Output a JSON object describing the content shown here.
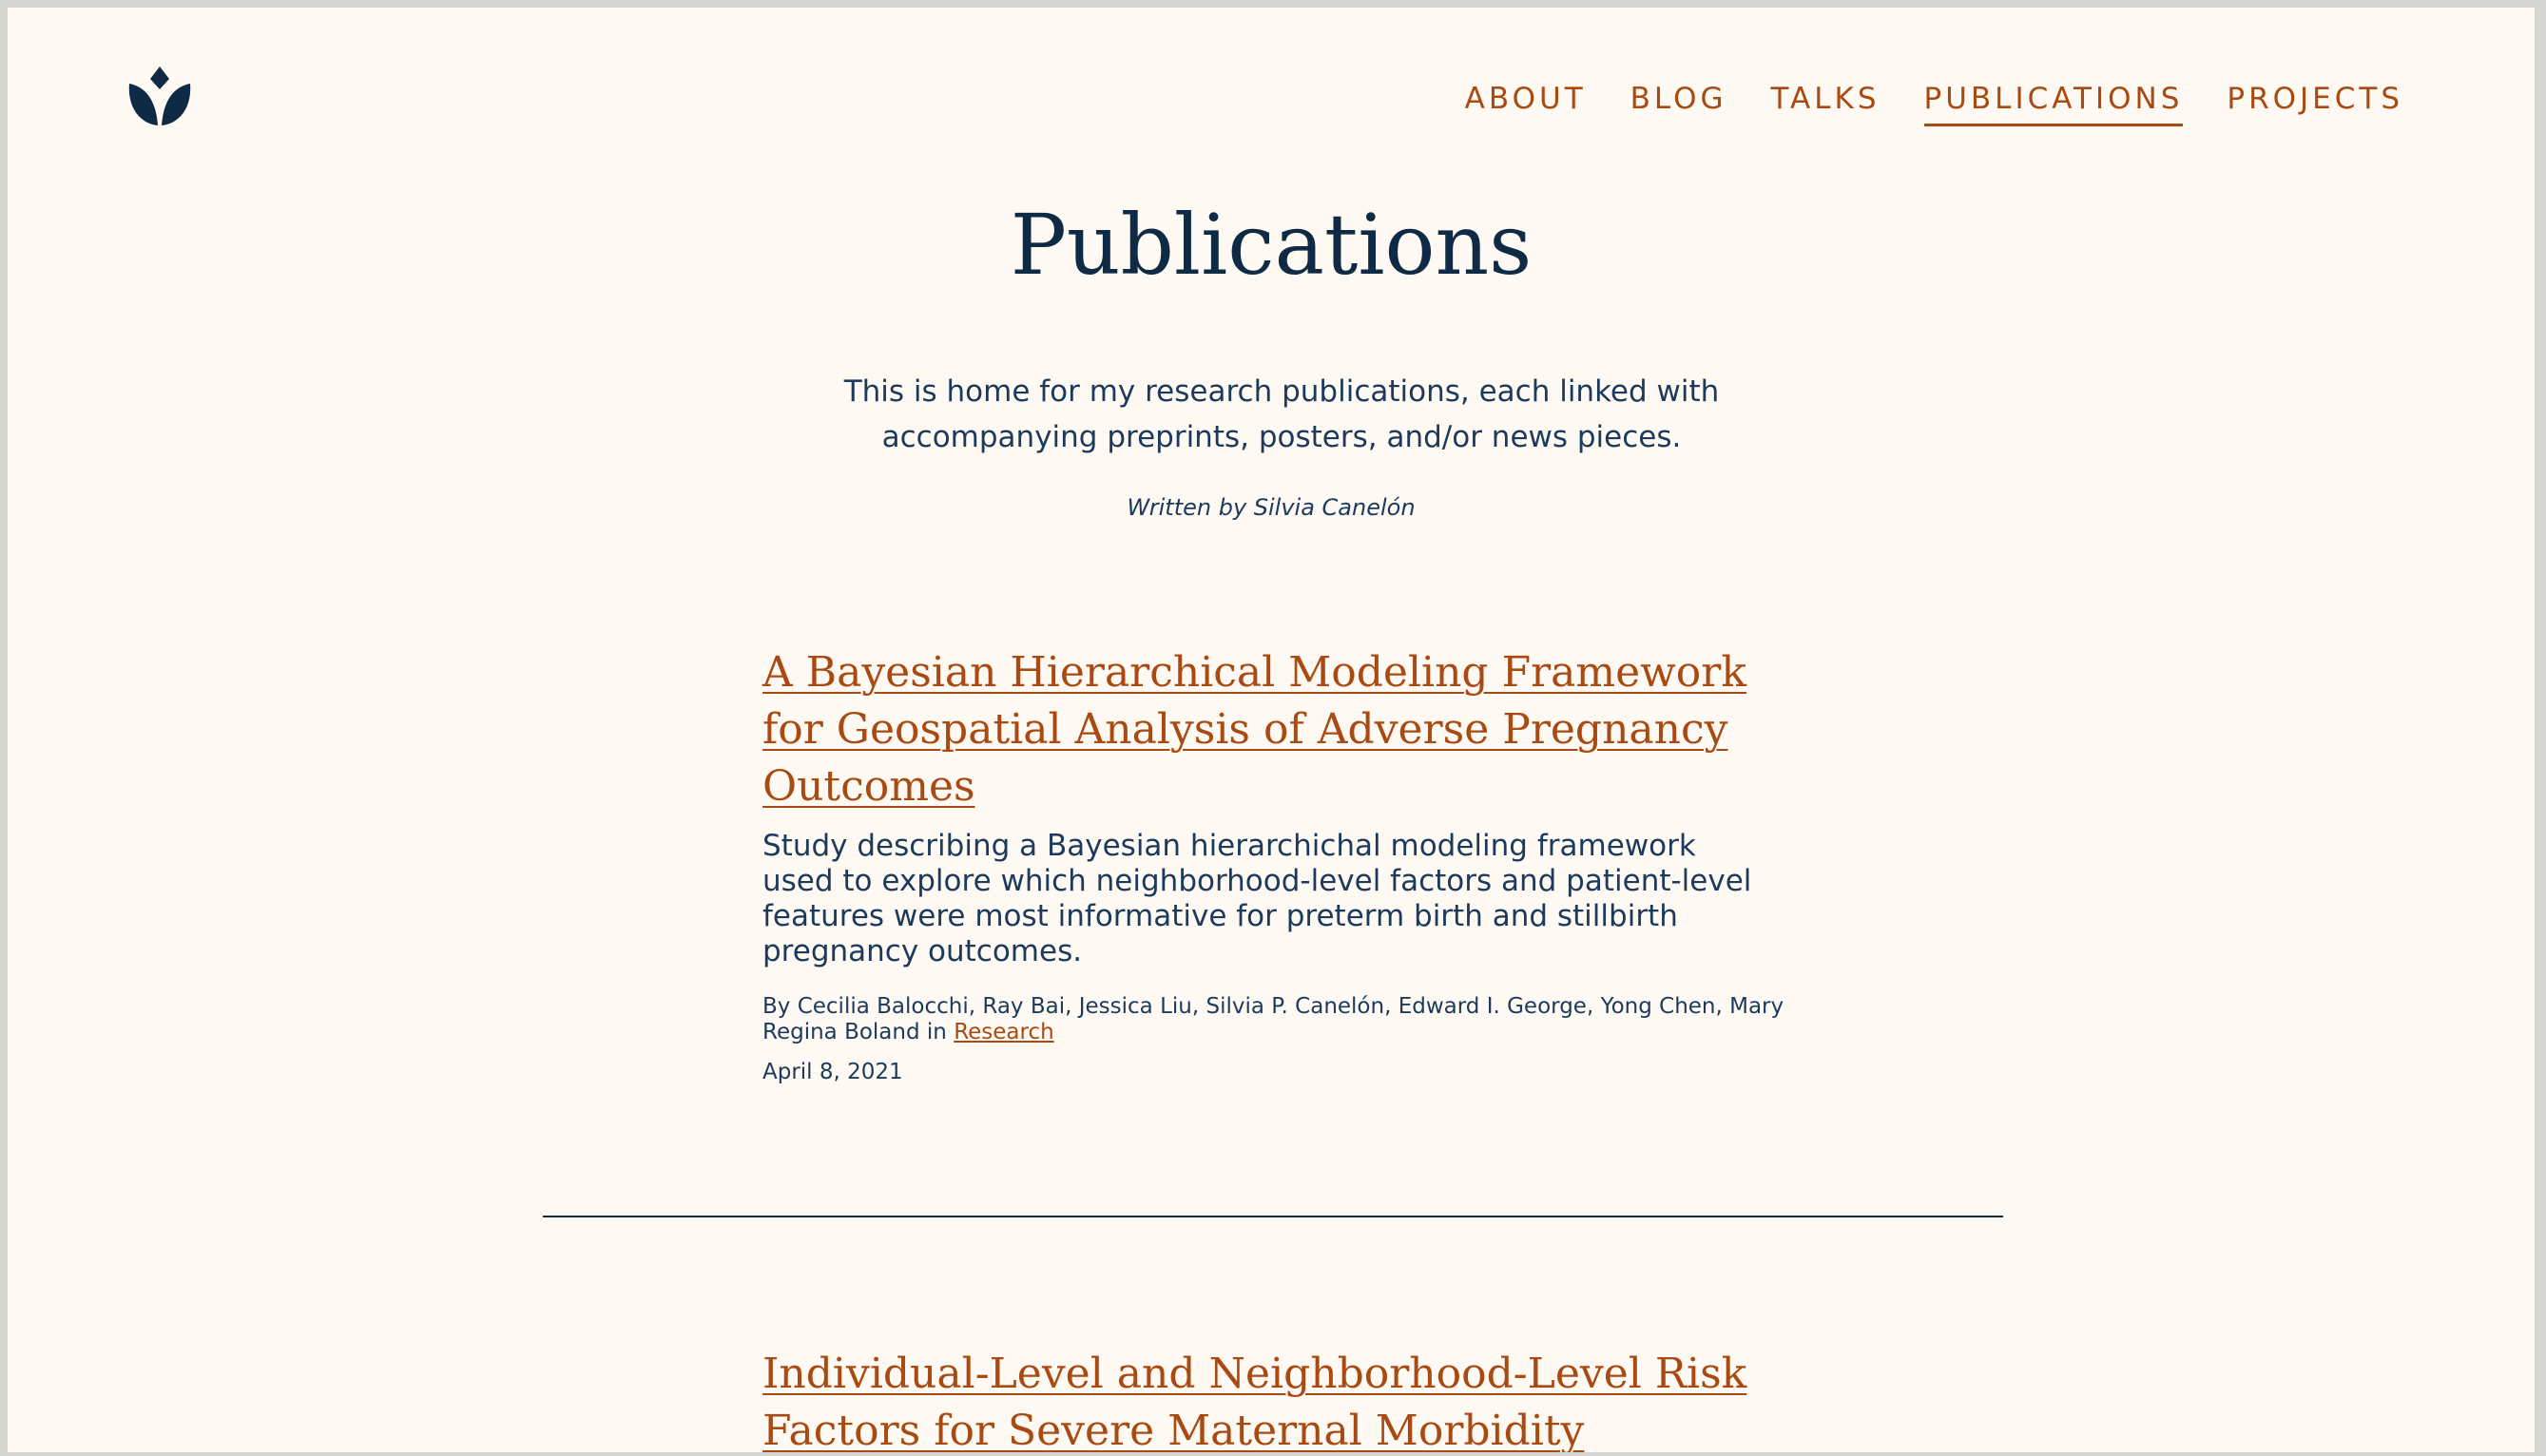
{
  "nav": {
    "logo_icon": "lotus-icon",
    "items": [
      {
        "label": "ABOUT",
        "active": false
      },
      {
        "label": "BLOG",
        "active": false
      },
      {
        "label": "TALKS",
        "active": false
      },
      {
        "label": "PUBLICATIONS",
        "active": true
      },
      {
        "label": "PROJECTS",
        "active": false
      }
    ]
  },
  "page": {
    "title": "Publications",
    "intro": "This is home for my research publications, each linked with accompanying preprints, posters, and/or news pieces.",
    "byline": "Written by Silvia Canelón"
  },
  "publications": [
    {
      "title": "A Bayesian Hierarchical Modeling Framework for Geospatial Analysis of Adverse Pregnancy Outcomes",
      "description": "Study describing a Bayesian hierarchichal modeling framework used to explore which neighborhood-level factors and patient-level features were most informative for preterm birth and stillbirth pregnancy outcomes.",
      "authors": "By Cecilia Balocchi, Ray Bai, Jessica Liu, Silvia P. Canelón, Edward I. George, Yong Chen, Mary Regina Boland in",
      "category": "Research",
      "date": "April 8, 2021"
    },
    {
      "title": "Individual-Level and Neighborhood-Level Risk Factors for Severe Maternal Morbidity"
    }
  ],
  "colors": {
    "background": "#fef9f2",
    "accent": "#a84a12",
    "navy": "#0f2a44",
    "text": "#1c3a5c"
  }
}
